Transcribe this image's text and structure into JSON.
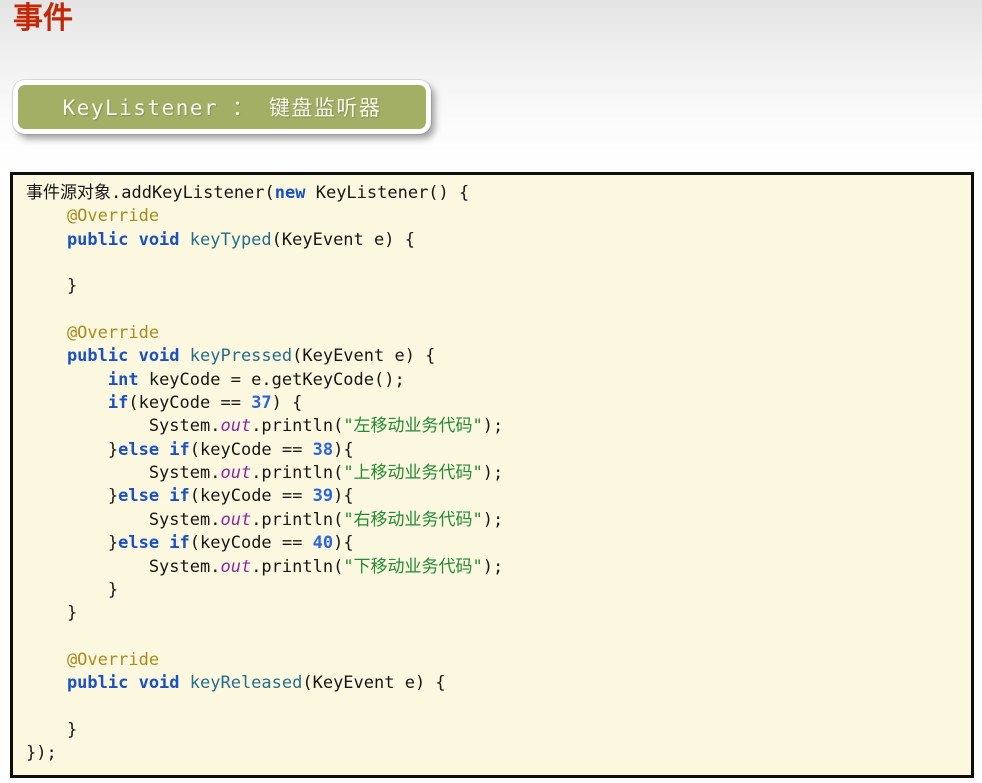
{
  "header": {
    "title": "事件",
    "title_color": "#c22806"
  },
  "banner": {
    "label": "KeyListener ： 键盘监听器",
    "bg_color": "#a3af64",
    "text_color": "#f6f6ec"
  },
  "code_block": {
    "bg_color": "#fcf7df",
    "border_color": "#0d0d0d",
    "token_colors": {
      "plain": "#161616",
      "keyword": "#1a50c2",
      "method": "#256e89",
      "annotation": "#a98b1e",
      "number": "#2a66de",
      "string": "#238a35",
      "field": "#8c28a3"
    },
    "lines": [
      [
        [
          "plain",
          "事件源对象.addKeyListener("
        ],
        [
          "keyword",
          "new"
        ],
        [
          "plain",
          " KeyListener() {"
        ]
      ],
      [
        [
          "annotation",
          "    @Override"
        ]
      ],
      [
        [
          "keyword",
          "    public void "
        ],
        [
          "method",
          "keyTyped"
        ],
        [
          "plain",
          "(KeyEvent e) {"
        ]
      ],
      [],
      [
        [
          "plain",
          "    }"
        ]
      ],
      [],
      [
        [
          "annotation",
          "    @Override"
        ]
      ],
      [
        [
          "keyword",
          "    public void "
        ],
        [
          "method",
          "keyPressed"
        ],
        [
          "plain",
          "(KeyEvent e) {"
        ]
      ],
      [
        [
          "keyword",
          "        int"
        ],
        [
          "plain",
          " keyCode = e.getKeyCode();"
        ]
      ],
      [
        [
          "keyword",
          "        if"
        ],
        [
          "plain",
          "(keyCode == "
        ],
        [
          "number",
          "37"
        ],
        [
          "plain",
          ") {"
        ]
      ],
      [
        [
          "plain",
          "            System."
        ],
        [
          "field",
          "out"
        ],
        [
          "plain",
          ".println("
        ],
        [
          "string",
          "\"左移动业务代码\""
        ],
        [
          "plain",
          ");"
        ]
      ],
      [
        [
          "plain",
          "        }"
        ],
        [
          "keyword",
          "else if"
        ],
        [
          "plain",
          "(keyCode == "
        ],
        [
          "number",
          "38"
        ],
        [
          "plain",
          "){"
        ]
      ],
      [
        [
          "plain",
          "            System."
        ],
        [
          "field",
          "out"
        ],
        [
          "plain",
          ".println("
        ],
        [
          "string",
          "\"上移动业务代码\""
        ],
        [
          "plain",
          ");"
        ]
      ],
      [
        [
          "plain",
          "        }"
        ],
        [
          "keyword",
          "else if"
        ],
        [
          "plain",
          "(keyCode == "
        ],
        [
          "number",
          "39"
        ],
        [
          "plain",
          "){"
        ]
      ],
      [
        [
          "plain",
          "            System."
        ],
        [
          "field",
          "out"
        ],
        [
          "plain",
          ".println("
        ],
        [
          "string",
          "\"右移动业务代码\""
        ],
        [
          "plain",
          ");"
        ]
      ],
      [
        [
          "plain",
          "        }"
        ],
        [
          "keyword",
          "else if"
        ],
        [
          "plain",
          "(keyCode == "
        ],
        [
          "number",
          "40"
        ],
        [
          "plain",
          "){"
        ]
      ],
      [
        [
          "plain",
          "            System."
        ],
        [
          "field",
          "out"
        ],
        [
          "plain",
          ".println("
        ],
        [
          "string",
          "\"下移动业务代码\""
        ],
        [
          "plain",
          ");"
        ]
      ],
      [
        [
          "plain",
          "        }"
        ]
      ],
      [
        [
          "plain",
          "    }"
        ]
      ],
      [],
      [
        [
          "annotation",
          "    @Override"
        ]
      ],
      [
        [
          "keyword",
          "    public void "
        ],
        [
          "method",
          "keyReleased"
        ],
        [
          "plain",
          "(KeyEvent e) {"
        ]
      ],
      [],
      [
        [
          "plain",
          "    }"
        ]
      ],
      [
        [
          "plain",
          "});"
        ]
      ]
    ]
  }
}
